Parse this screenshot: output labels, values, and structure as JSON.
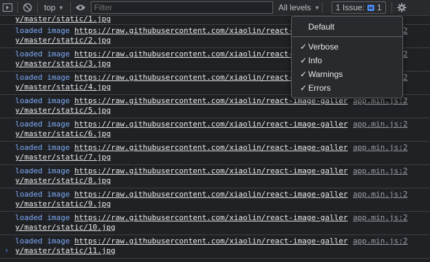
{
  "toolbar": {
    "context": "top",
    "filter_placeholder": "Filter",
    "levels_label": "All levels",
    "issues_label": "1 Issue:",
    "issues_count": "1"
  },
  "log": {
    "message": "loaded image",
    "url_prefix": "https://raw.githubusercontent.com/xiaolin/react-image-galler",
    "source": "app.min.js:2",
    "first_row_tail": "y/master/static/1.jpg",
    "rows": [
      {
        "tail": "y/master/static/2.jpg"
      },
      {
        "tail": "y/master/static/3.jpg"
      },
      {
        "tail": "y/master/static/4.jpg"
      },
      {
        "tail": "y/master/static/5.jpg"
      },
      {
        "tail": "y/master/static/6.jpg"
      },
      {
        "tail": "y/master/static/7.jpg"
      },
      {
        "tail": "y/master/static/8.jpg"
      },
      {
        "tail": "y/master/static/9.jpg"
      },
      {
        "tail": "y/master/static/10.jpg"
      },
      {
        "tail": "y/master/static/11.jpg"
      }
    ],
    "prompt": "›"
  },
  "menu": {
    "default": "Default",
    "items": [
      {
        "label": "Verbose",
        "check": "✓"
      },
      {
        "label": "Info",
        "check": "✓"
      },
      {
        "label": "Warnings",
        "check": "✓"
      },
      {
        "label": "Errors",
        "check": "✓"
      }
    ]
  },
  "icons": {
    "toggle_sidebar": "sidebar-toggle-icon",
    "clear": "clear-console-icon",
    "eye": "eye-icon",
    "issue": "issue-message-icon",
    "settings": "gear-icon"
  },
  "colors": {
    "background": "#202124",
    "toolbar": "#292a2d",
    "message": "#7cacf8",
    "url": "#e8eaed",
    "accent": "#4c8bf5"
  }
}
